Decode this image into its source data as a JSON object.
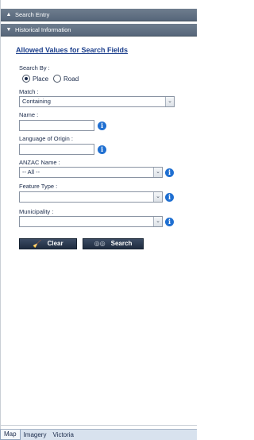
{
  "panels": {
    "search_entry": {
      "label": "Search Entry",
      "state": "collapsed"
    },
    "historical_information": {
      "label": "Historical Information",
      "state": "expanded"
    }
  },
  "form": {
    "allowed_values_link": "Allowed Values for Search Fields",
    "search_by": {
      "label": "Search By :",
      "options": [
        "Place",
        "Road"
      ],
      "selected": "Place"
    },
    "match": {
      "label": "Match :",
      "value": "Containing"
    },
    "name": {
      "label": "Name :",
      "value": ""
    },
    "language_of_origin": {
      "label": "Language of Origin :",
      "value": ""
    },
    "anzac_name": {
      "label": "ANZAC Name :",
      "value": "-- All --"
    },
    "feature_type": {
      "label": "Feature Type :",
      "value": ""
    },
    "municipality": {
      "label": "Municipality :",
      "value": ""
    },
    "buttons": {
      "clear": "Clear",
      "search": "Search"
    }
  },
  "tabs": [
    {
      "label": "Map",
      "active": true
    },
    {
      "label": "Imagery",
      "active": false
    },
    {
      "label": "Victoria",
      "active": false
    }
  ],
  "icons": {
    "panel_collapsed": "chevron-up-icon",
    "panel_expanded": "chevron-down-icon",
    "info": "info-icon",
    "dropdown": "dropdown-arrow-icon",
    "clear": "broom-icon",
    "search": "binoculars-icon"
  },
  "colors": {
    "panel_header": "#5f6f82",
    "link": "#1c3f8c",
    "info_icon": "#1f6fd1",
    "button": "#2a3850",
    "tabbar": "#d8e2ee"
  }
}
